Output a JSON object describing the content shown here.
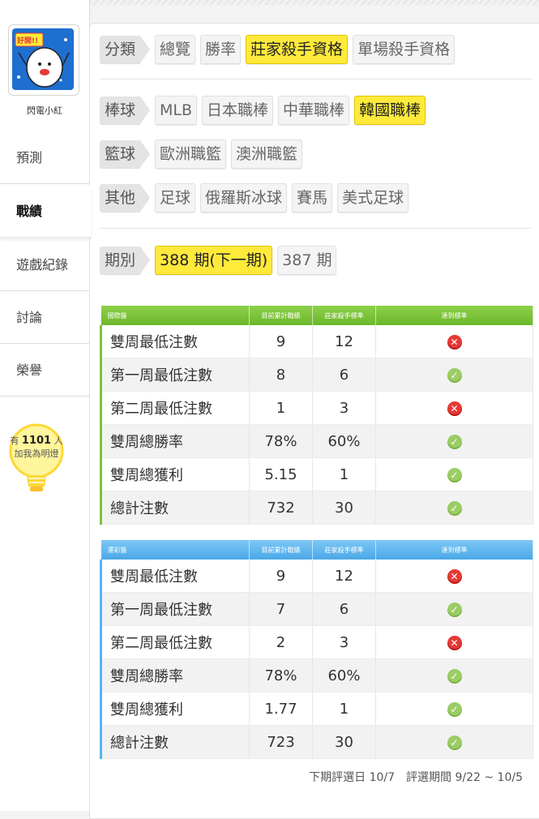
{
  "sidebar": {
    "user_name": "閃電小紅",
    "avatar_caption": "好開!!",
    "nav": [
      "預測",
      "戰績",
      "遊戲紀錄",
      "討論",
      "榮譽"
    ],
    "active_index": 1,
    "fans": {
      "prefix": "有",
      "count": "1101",
      "suffix": "人",
      "cta": "加我為明燈"
    }
  },
  "filters": {
    "category": {
      "label": "分類",
      "items": [
        "總覽",
        "勝率",
        "莊家殺手資格",
        "單場殺手資格"
      ],
      "selected": 2
    },
    "baseball": {
      "label": "棒球",
      "items": [
        "MLB",
        "日本職棒",
        "中華職棒",
        "韓國職棒"
      ],
      "selected": 3
    },
    "basketball": {
      "label": "籃球",
      "items": [
        "歐洲職籃",
        "澳洲職籃"
      ],
      "selected": -1
    },
    "other": {
      "label": "其他",
      "items": [
        "足球",
        "俄羅斯冰球",
        "賽馬",
        "美式足球"
      ],
      "selected": -1
    },
    "period": {
      "label": "期別",
      "items": [
        "388 期(下一期)",
        "387 期"
      ],
      "selected": 0
    }
  },
  "tables": [
    {
      "title": "國際盤",
      "headers": [
        "目前累計戰績",
        "莊家殺手標準",
        "達到標準"
      ],
      "rows": [
        {
          "name": "雙周最低注數",
          "current": "9",
          "standard": "12",
          "met": false
        },
        {
          "name": "第一周最低注數",
          "current": "8",
          "standard": "6",
          "met": true
        },
        {
          "name": "第二周最低注數",
          "current": "1",
          "standard": "3",
          "met": false
        },
        {
          "name": "雙周總勝率",
          "current": "78%",
          "standard": "60%",
          "met": true
        },
        {
          "name": "雙周總獲利",
          "current": "5.15",
          "standard": "1",
          "met": true
        },
        {
          "name": "總計注數",
          "current": "732",
          "standard": "30",
          "met": true
        }
      ]
    },
    {
      "title": "運彩盤",
      "headers": [
        "目前累計戰績",
        "莊家殺手標準",
        "達到標準"
      ],
      "rows": [
        {
          "name": "雙周最低注數",
          "current": "9",
          "standard": "12",
          "met": false
        },
        {
          "name": "第一周最低注數",
          "current": "7",
          "standard": "6",
          "met": true
        },
        {
          "name": "第二周最低注數",
          "current": "2",
          "standard": "3",
          "met": false
        },
        {
          "name": "雙周總勝率",
          "current": "78%",
          "standard": "60%",
          "met": true
        },
        {
          "name": "雙周總獲利",
          "current": "1.77",
          "standard": "1",
          "met": true
        },
        {
          "name": "總計注數",
          "current": "723",
          "standard": "30",
          "met": true
        }
      ]
    }
  ],
  "footer": "下期評選日 10/7　評選期間 9/22 ~ 10/5",
  "colors": {
    "selected": "#ffea3b",
    "green_header": "#7dc23a",
    "blue_header": "#5ab3ee",
    "ok": "#9ccc65",
    "fail": "#e53935"
  }
}
